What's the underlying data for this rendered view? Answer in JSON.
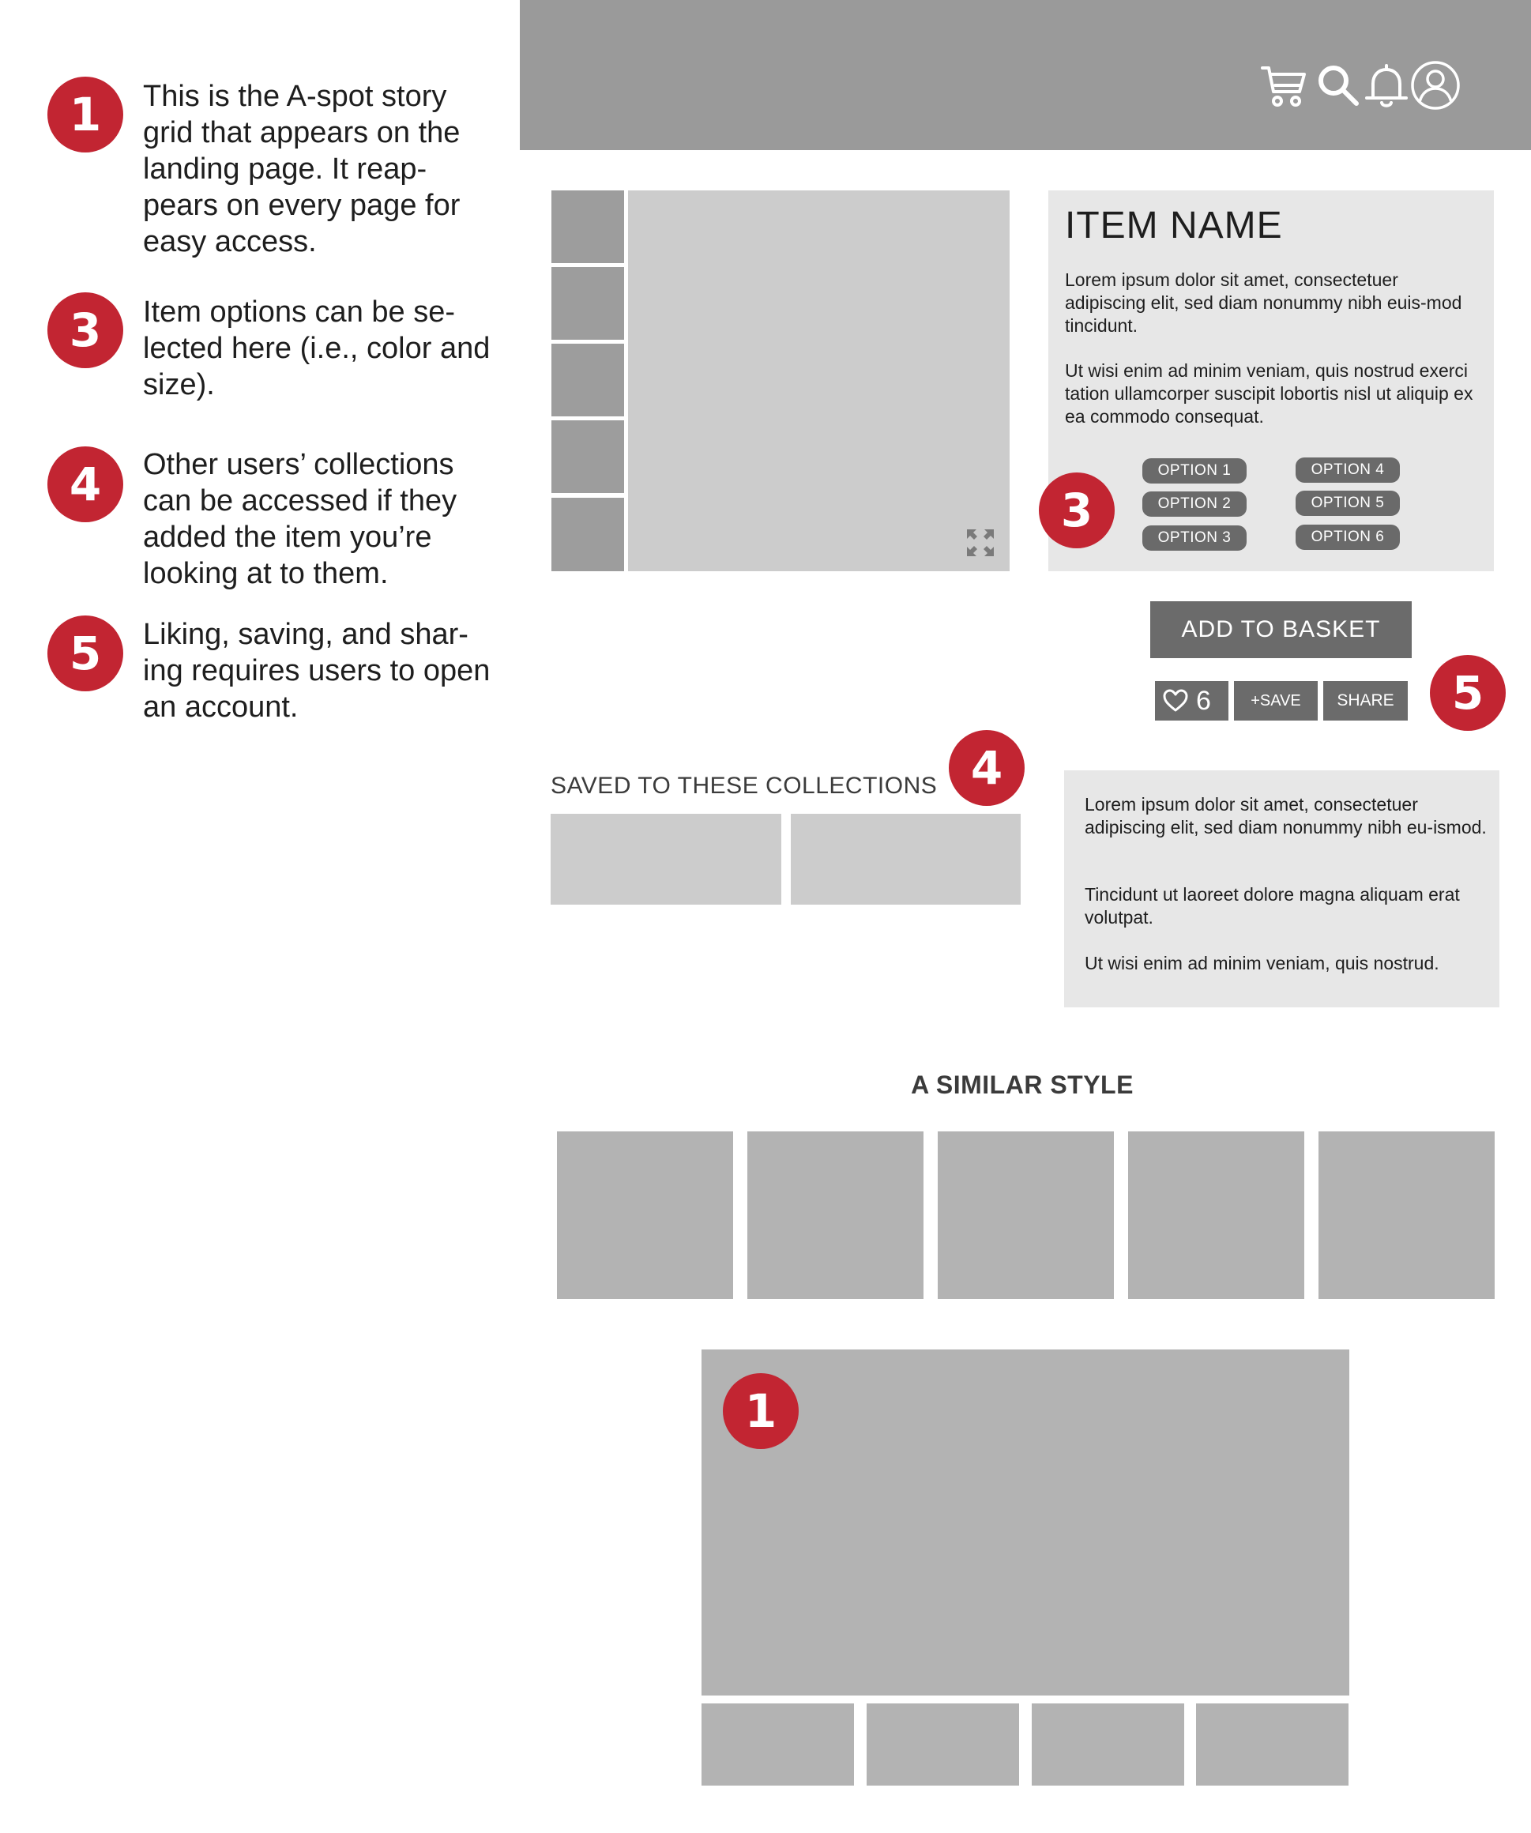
{
  "legend": [
    {
      "badge": "1",
      "text": "This is the A-spot story grid that appears on the landing page. It reap-pears on every page for easy access."
    },
    {
      "badge": "3",
      "text": "Item options can be se-lected here (i.e., color and size)."
    },
    {
      "badge": "4",
      "text": "Other users’ collections can be accessed if they added the item you’re looking at to them."
    },
    {
      "badge": "5",
      "text": "Liking, saving, and shar-ing requires users to open an account."
    }
  ],
  "header": {
    "icons": [
      "cart-icon",
      "search-icon",
      "bell-icon",
      "user-icon"
    ]
  },
  "product": {
    "name": "ITEM NAME",
    "desc_1": "Lorem ipsum dolor sit amet, consectetuer adipiscing elit, sed diam nonummy nibh euis-mod tincidunt.",
    "desc_2": "Ut wisi enim ad minim veniam, quis nostrud exerci tation ullamcorper suscipit lobortis nisl ut aliquip ex ea commodo consequat.",
    "options": [
      "OPTION 1",
      "OPTION 2",
      "OPTION 3",
      "OPTION 4",
      "OPTION 5",
      "OPTION 6"
    ],
    "options_badge": "3"
  },
  "actions": {
    "add_to_basket": "ADD TO BASKET",
    "like_count": "6",
    "save_label": "+SAVE",
    "share_label": "SHARE",
    "badge": "5"
  },
  "collections": {
    "title": "SAVED TO THESE COLLECTIONS",
    "badge": "4"
  },
  "description": {
    "p1": "Lorem ipsum dolor sit amet, consectetuer adipiscing elit, sed diam nonummy nibh eu-ismod.",
    "p2": "Tincidunt ut laoreet dolore magna aliquam erat volutpat.",
    "p3": "Ut wisi enim ad minim veniam, quis nostrud."
  },
  "similar": {
    "title": "A SIMILAR STYLE"
  },
  "story_grid": {
    "badge": "1"
  },
  "colors": {
    "accent_red": "#c22532",
    "header_gray": "#9a9a9a",
    "button_gray": "#6b6b6b",
    "panel_gray": "#e7e7e7"
  }
}
